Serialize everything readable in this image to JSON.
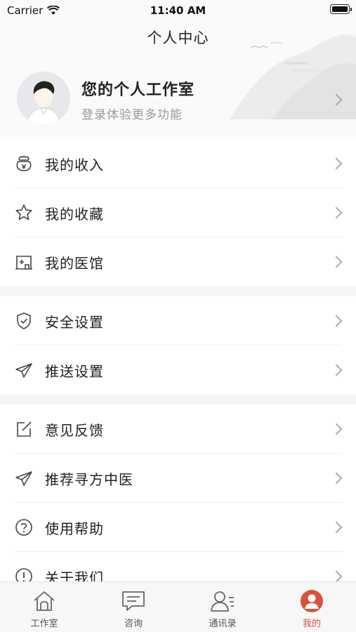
{
  "status_bar": {
    "carrier": "Carrier",
    "time": "11:40 AM"
  },
  "nav": {
    "title": "个人中心"
  },
  "profile": {
    "name": "您的个人工作室",
    "subtitle": "登录体验更多功能"
  },
  "groups": [
    {
      "items": [
        {
          "label": "我的收入",
          "icon": "wallet-icon"
        },
        {
          "label": "我的收藏",
          "icon": "star-icon"
        },
        {
          "label": "我的医馆",
          "icon": "clinic-icon"
        }
      ]
    },
    {
      "items": [
        {
          "label": "安全设置",
          "icon": "shield-icon"
        },
        {
          "label": "推送设置",
          "icon": "send-icon"
        }
      ]
    },
    {
      "items": [
        {
          "label": "意见反馈",
          "icon": "edit-icon"
        },
        {
          "label": "推荐寻方中医",
          "icon": "send-icon"
        },
        {
          "label": "使用帮助",
          "icon": "help-icon"
        },
        {
          "label": "关于我们",
          "icon": "info-icon"
        }
      ]
    }
  ],
  "tabbar": {
    "active_color": "#d9533c",
    "tabs": [
      {
        "label": "工作室",
        "icon": "home-icon"
      },
      {
        "label": "咨询",
        "icon": "chat-icon"
      },
      {
        "label": "通讯录",
        "icon": "contacts-icon"
      },
      {
        "label": "我的",
        "icon": "user-icon",
        "active": true
      }
    ]
  }
}
